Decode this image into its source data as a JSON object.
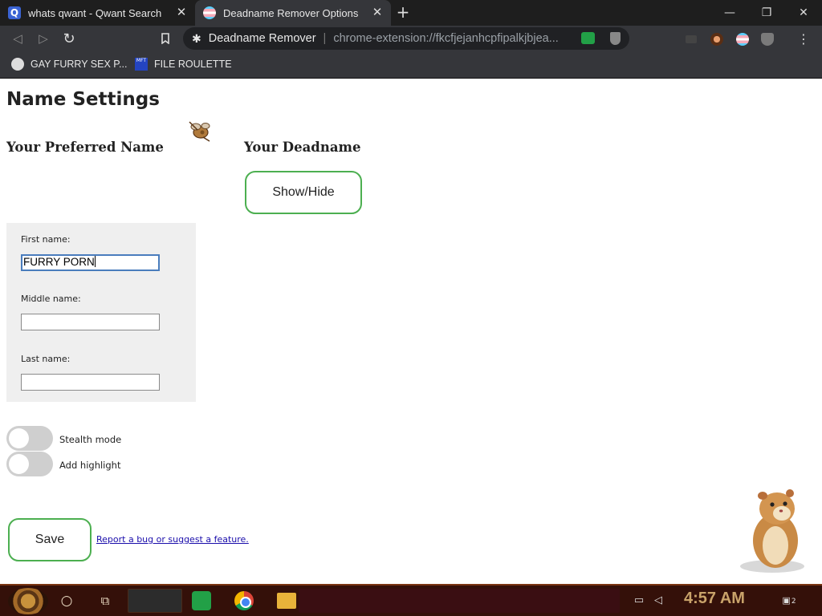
{
  "browser": {
    "tabs": [
      {
        "title": "whats qwant - Qwant Search",
        "favicon": "qwant-icon",
        "favicon_glyph": "Q",
        "active": false
      },
      {
        "title": "Deadname Remover Options",
        "favicon": "trans-flag-icon",
        "active": true
      }
    ],
    "close_glyph": "✕",
    "new_tab_glyph": "+",
    "window_controls": {
      "minimize": "—",
      "restore": "❐",
      "close": "✕"
    },
    "nav": {
      "back": "◁",
      "forward": "▷",
      "reload": "↻",
      "bookmark": "🔖"
    },
    "omnibox": {
      "site_name": "Deadname Remover",
      "separator": "|",
      "url": "chrome-extension://fkcfjejanhcpfipalkjbjea..."
    },
    "menu_glyph": "⋮",
    "bookmarks": [
      {
        "label": "GAY FURRY SEX P...",
        "icon": "globe-icon"
      },
      {
        "label": "FILE ROULETTE",
        "icon": "mft-icon",
        "icon_text": "MFT"
      }
    ]
  },
  "page": {
    "title": "Name Settings",
    "preferred_heading": "Your Preferred Name",
    "deadname_heading": "Your Deadname",
    "show_hide_label": "Show/Hide",
    "form": {
      "first_label": "First name:",
      "first_value": "FURRY PORN",
      "middle_label": "Middle name:",
      "middle_value": "",
      "last_label": "Last name:",
      "last_value": ""
    },
    "toggles": [
      {
        "label": "Stealth mode",
        "on": false
      },
      {
        "label": "Add highlight",
        "on": false
      }
    ],
    "save_label": "Save",
    "report_link": "Report a bug or suggest a feature."
  },
  "taskbar": {
    "clock": "4:57 AM",
    "cortana_glyph": "○",
    "taskview_glyph": "⧉",
    "notification_count": "2"
  },
  "colors": {
    "accent_green": "#4caf50",
    "link": "#1a0dab",
    "taskbar": "#341009"
  }
}
